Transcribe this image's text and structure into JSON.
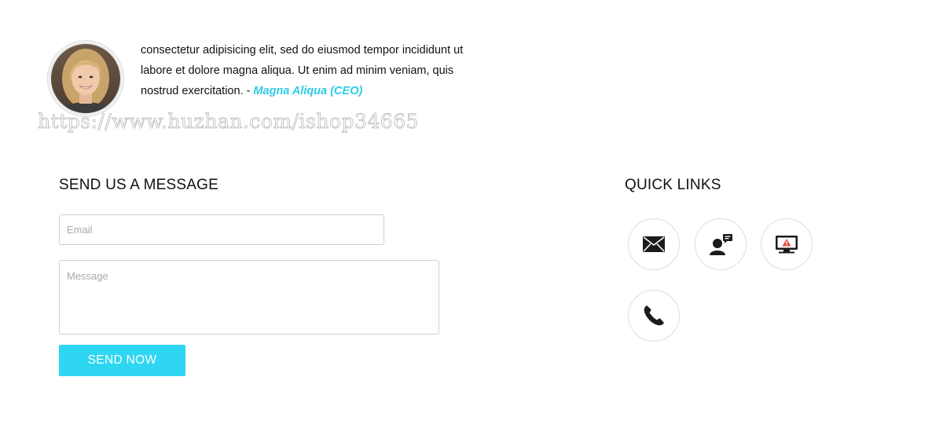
{
  "testimonial": {
    "quote": "consectetur adipisicing elit, sed do eiusmod tempor incididunt ut labore et dolore magna aliqua. Ut enim ad minim veniam, quis nostrud exercitation. - ",
    "author": "Magna Aliqua (CEO)"
  },
  "watermark": "https://www.huzhan.com/ishop34665",
  "contact_form": {
    "heading": "SEND US A MESSAGE",
    "email_placeholder": "Email",
    "message_placeholder": "Message",
    "submit_label": "SEND NOW"
  },
  "quick_links": {
    "heading": "QUICK LINKS",
    "items": [
      {
        "icon": "envelope-icon"
      },
      {
        "icon": "support-chat-icon"
      },
      {
        "icon": "monitor-alert-icon"
      },
      {
        "icon": "phone-icon"
      }
    ]
  },
  "colors": {
    "accent": "#2ed6f2",
    "author_text": "#2ecbe8",
    "alert_icon": "#e54a3f"
  }
}
